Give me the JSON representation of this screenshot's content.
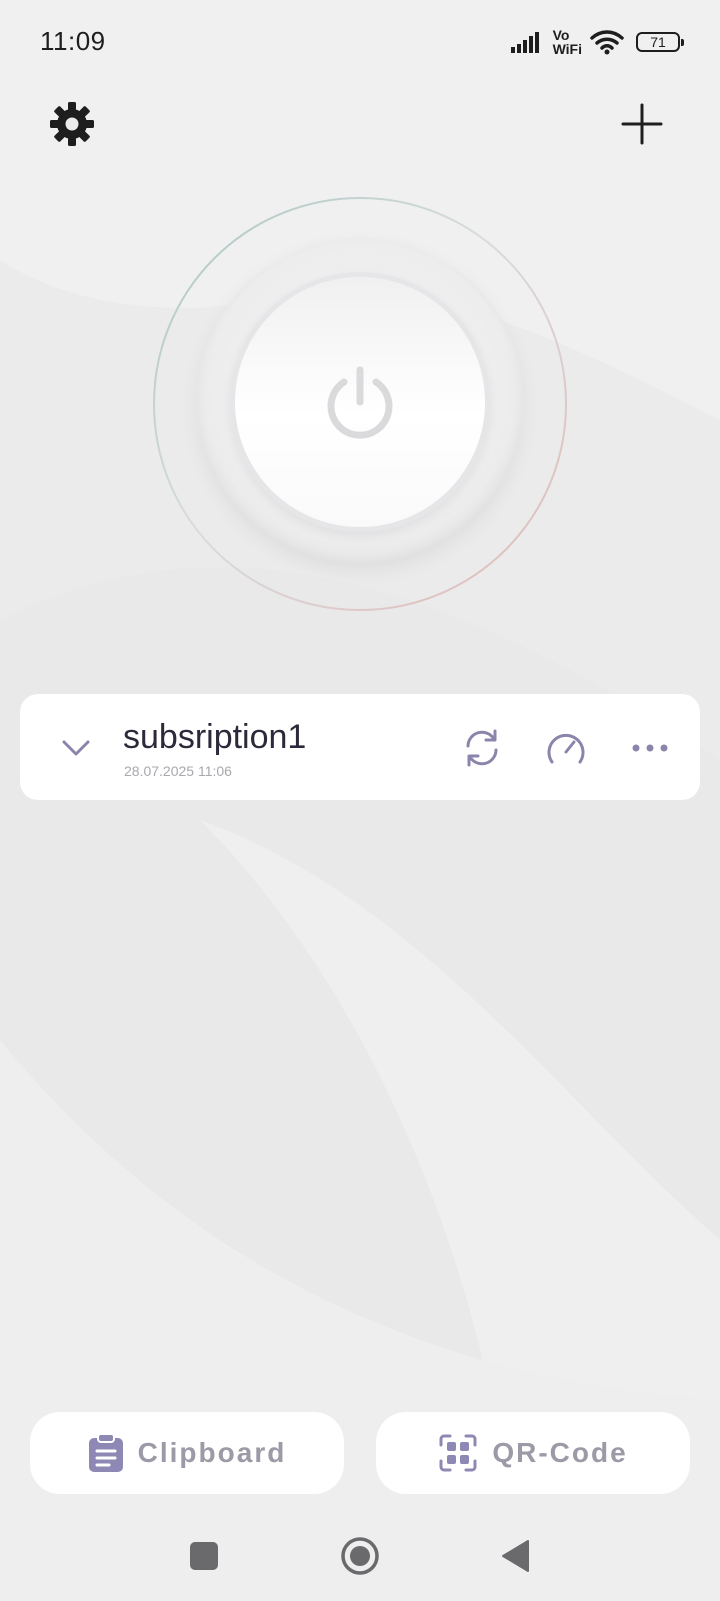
{
  "status_bar": {
    "time": "11:09",
    "network_label_top": "Vo",
    "network_label_bottom": "WiFi",
    "battery_level": "71"
  },
  "icons": {
    "settings": "gear-icon",
    "add": "plus-icon",
    "power": "power-icon",
    "expand": "chevron-down-icon",
    "refresh": "refresh-icon",
    "speed_test": "speedometer-icon",
    "more": "more-horizontal-icon",
    "clipboard": "clipboard-icon",
    "qr": "qr-code-icon"
  },
  "subscription": {
    "name": "subsription1",
    "updated": "28.07.2025 11:06"
  },
  "bottom_actions": {
    "clipboard_label": "Clipboard",
    "qr_label": "QR-Code"
  },
  "colors": {
    "accent_icon": "#8a86ab",
    "clipboard_icon": "#8e88b5",
    "text_primary": "#2b2a3a",
    "text_muted": "#9b9aa6",
    "background": "#ebebec"
  }
}
